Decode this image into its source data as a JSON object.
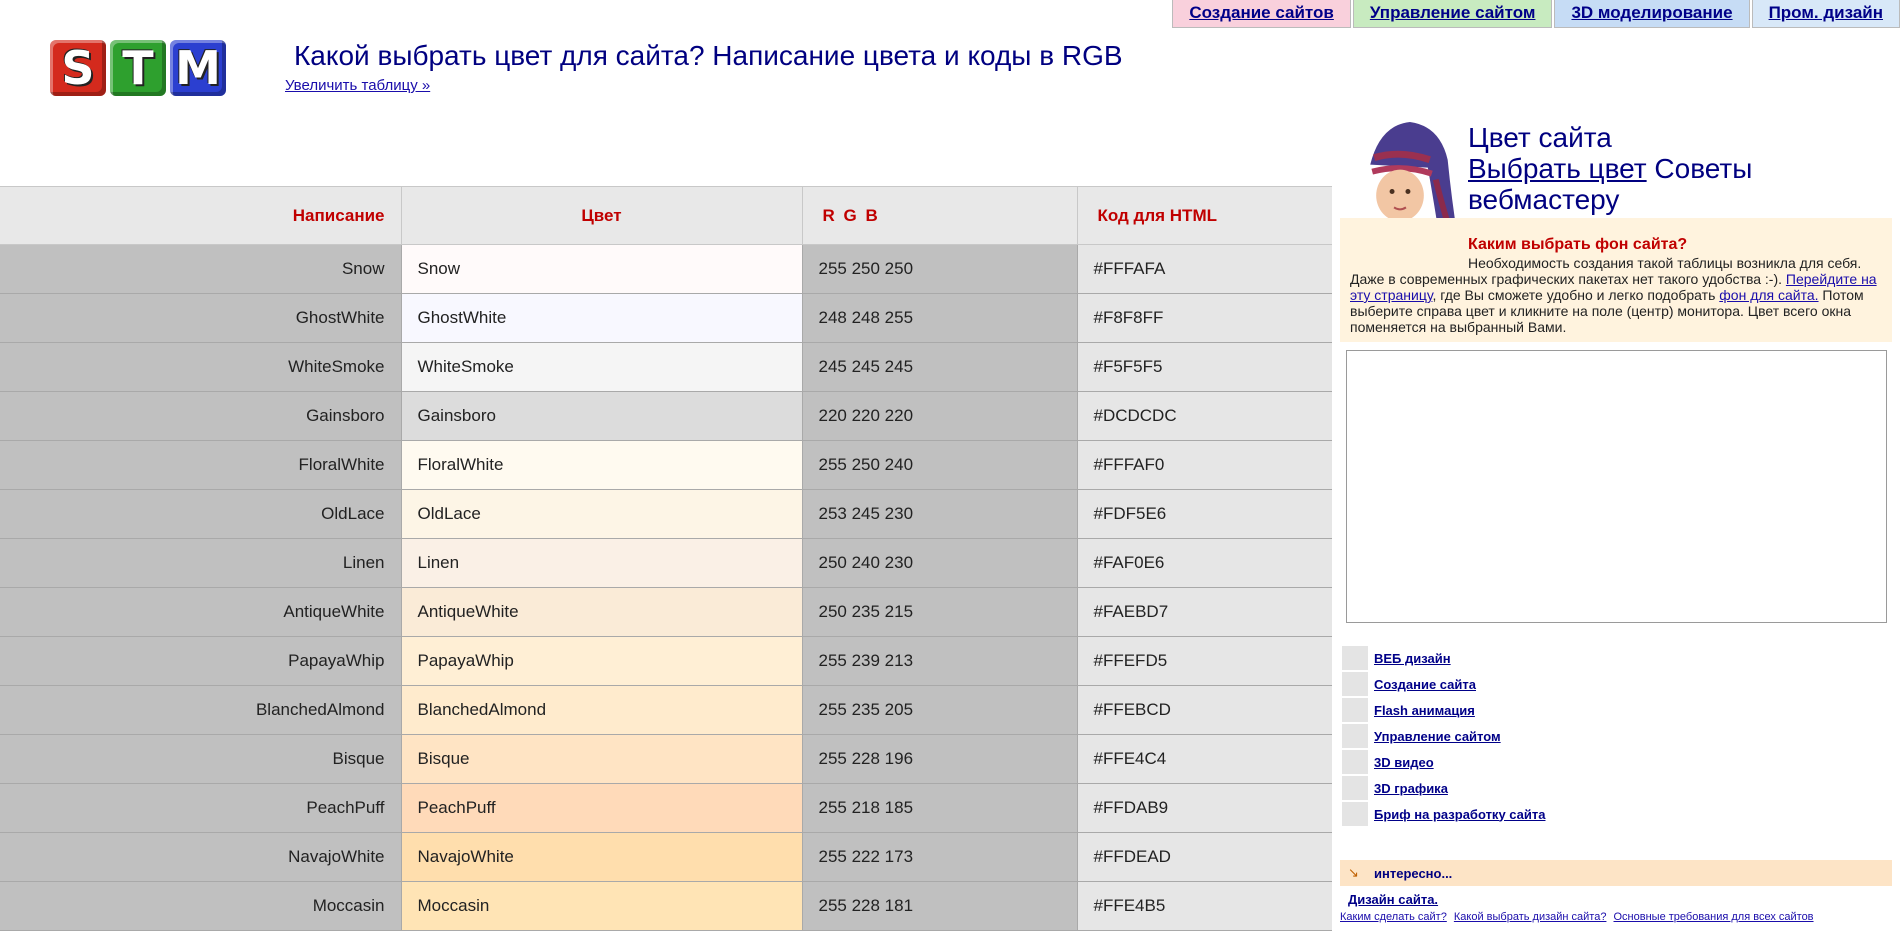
{
  "nav": {
    "tabs": [
      {
        "label": "Создание сайтов",
        "color": "#f9d0dc"
      },
      {
        "label": "Управление сайтом",
        "color": "#c8ebc0"
      },
      {
        "label": "3D моделирование",
        "color": "#c6dcf5"
      },
      {
        "label": "Пром. дизайн",
        "color": "#d8e8f8"
      }
    ]
  },
  "logo": {
    "letters": [
      "S",
      "T",
      "M"
    ]
  },
  "header": {
    "title": "Какой выбрать цвет для сайта? Написание цвета и коды в RGB",
    "enlarge_link": "Увеличить таблицу »"
  },
  "table": {
    "headers": {
      "name": "Написание",
      "swatch": "Цвет",
      "rgb": "R G B",
      "hex": "Код для HTML"
    },
    "rows": [
      {
        "name": "Snow",
        "rgb": "255 250 250",
        "hex": "#FFFAFA"
      },
      {
        "name": "GhostWhite",
        "rgb": "248 248 255",
        "hex": "#F8F8FF"
      },
      {
        "name": "WhiteSmoke",
        "rgb": "245 245 245",
        "hex": "#F5F5F5"
      },
      {
        "name": "Gainsboro",
        "rgb": "220 220 220",
        "hex": "#DCDCDC"
      },
      {
        "name": "FloralWhite",
        "rgb": "255 250 240",
        "hex": "#FFFAF0"
      },
      {
        "name": "OldLace",
        "rgb": "253 245 230",
        "hex": "#FDF5E6"
      },
      {
        "name": "Linen",
        "rgb": "250 240 230",
        "hex": "#FAF0E6"
      },
      {
        "name": "AntiqueWhite",
        "rgb": "250 235 215",
        "hex": "#FAEBD7"
      },
      {
        "name": "PapayaWhip",
        "rgb": "255 239 213",
        "hex": "#FFEFD5"
      },
      {
        "name": "BlanchedAlmond",
        "rgb": "255 235 205",
        "hex": "#FFEBCD"
      },
      {
        "name": "Bisque",
        "rgb": "255 228 196",
        "hex": "#FFE4C4"
      },
      {
        "name": "PeachPuff",
        "rgb": "255 218 185",
        "hex": "#FFDAB9"
      },
      {
        "name": "NavajoWhite",
        "rgb": "255 222 173",
        "hex": "#FFDEAD"
      },
      {
        "name": "Moccasin",
        "rgb": "255 228 181",
        "hex": "#FFE4B5"
      }
    ]
  },
  "sidebar": {
    "intro_title": "Цвет сайта",
    "intro_link": "Выбрать цвет",
    "intro_suffix": " Советы вебмастеру",
    "tip_heading": "Каким выбрать фон сайта?",
    "tip_text_1": "Необходимость создания такой таблицы возникла для себя. Даже в современных графических пакетах нет такого удобства :-). ",
    "tip_link_1": "Перейдите на эту страницу",
    "tip_text_2": ", где Вы сможете удобно и легко подобрать ",
    "tip_link_2": "фон для сайта.",
    "tip_text_3": " Потом выберите справа цвет и кликните на поле (центр) монитора. Цвет всего окна поменяется на выбранный Вами.",
    "menu": [
      "ВЕБ дизайн",
      "Создание сайта",
      "Flash анимация",
      "Управление сайтом",
      "3D видео",
      "3D графика",
      "Бриф на разработку сайта"
    ],
    "interesting": "интересно...",
    "design_link": "Дизайн сайта.",
    "bottom_links": [
      "Каким сделать сайт?",
      "Какой выбрать дизайн сайта?",
      "Основные требования для всех сайтов"
    ]
  }
}
